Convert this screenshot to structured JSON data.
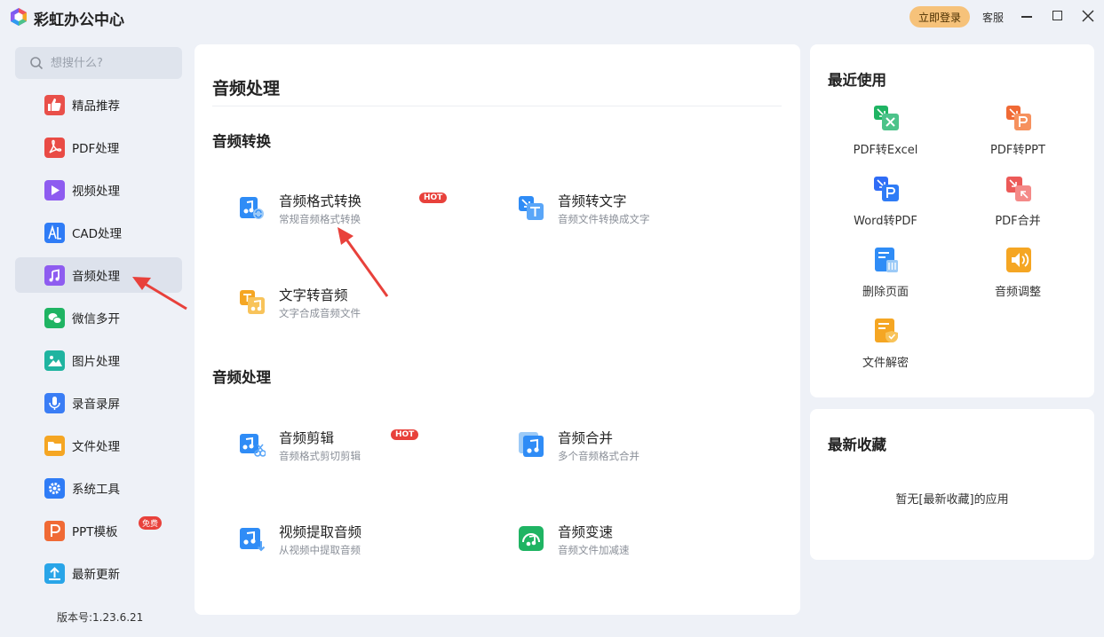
{
  "app": {
    "title": "彩虹办公中心",
    "login_label": "立即登录",
    "service_label": "客服",
    "logo_icon": "rainbow-logo-icon"
  },
  "sidebar": {
    "search_placeholder": "想搜什么?",
    "items": [
      {
        "label": "精品推荐",
        "icon": "thumbs-up-icon",
        "color": "#e9504a"
      },
      {
        "label": "PDF处理",
        "icon": "pdf-icon",
        "color": "#e94b45"
      },
      {
        "label": "视频处理",
        "icon": "play-icon",
        "color": "#8e5cf0"
      },
      {
        "label": "CAD处理",
        "icon": "cad-icon",
        "color": "#2f7cf6"
      },
      {
        "label": "音频处理",
        "icon": "music-icon",
        "color": "#8e5cf0"
      },
      {
        "label": "微信多开",
        "icon": "wechat-icon",
        "color": "#1fb463"
      },
      {
        "label": "图片处理",
        "icon": "image-icon",
        "color": "#1fb4a0"
      },
      {
        "label": "录音录屏",
        "icon": "microphone-icon",
        "color": "#3a7df5"
      },
      {
        "label": "文件处理",
        "icon": "folder-icon",
        "color": "#f5a623"
      },
      {
        "label": "系统工具",
        "icon": "gear-icon",
        "color": "#2f7cf6"
      },
      {
        "label": "PPT模板",
        "icon": "ppt-icon",
        "color": "#f06a35",
        "badge": "免费"
      },
      {
        "label": "最新更新",
        "icon": "upload-icon",
        "color": "#29a5e8"
      }
    ],
    "active_index": 4,
    "version": "版本号:1.23.6.21"
  },
  "main": {
    "title": "音频处理",
    "sections": [
      {
        "title": "音频转换",
        "tools": [
          {
            "name": "音频格式转换",
            "desc": "常规音频格式转换",
            "badge": "HOT",
            "icon": "audio-convert-icon"
          },
          {
            "name": "音频转文字",
            "desc": "音频文件转换成文字",
            "icon": "audio-to-text-icon"
          },
          {
            "name": "文字转音频",
            "desc": "文字合成音频文件",
            "icon": "text-to-audio-icon"
          }
        ]
      },
      {
        "title": "音频处理",
        "tools": [
          {
            "name": "音频剪辑",
            "desc": "音频格式剪切剪辑",
            "badge": "HOT",
            "icon": "audio-cut-icon"
          },
          {
            "name": "音频合并",
            "desc": "多个音频格式合并",
            "icon": "audio-merge-icon"
          },
          {
            "name": "视频提取音频",
            "desc": "从视频中提取音频",
            "icon": "video-extract-audio-icon"
          },
          {
            "name": "音频变速",
            "desc": "音频文件加减速",
            "icon": "audio-speed-icon"
          }
        ]
      }
    ]
  },
  "recent": {
    "title": "最近使用",
    "items": [
      {
        "label": "PDF转Excel",
        "icon": "pdf-to-excel-icon"
      },
      {
        "label": "PDF转PPT",
        "icon": "pdf-to-ppt-icon"
      },
      {
        "label": "Word转PDF",
        "icon": "word-to-pdf-icon"
      },
      {
        "label": "PDF合并",
        "icon": "pdf-merge-icon"
      },
      {
        "label": "删除页面",
        "icon": "delete-page-icon"
      },
      {
        "label": "音频调整",
        "icon": "audio-adjust-icon"
      },
      {
        "label": "文件解密",
        "icon": "file-decrypt-icon"
      }
    ]
  },
  "favorites": {
    "title": "最新收藏",
    "empty_text": "暂无[最新收藏]的应用"
  },
  "colors": {
    "accent_login": "#f6c27a",
    "hot_badge": "#e8413b",
    "annotation_arrow": "#e8413b"
  }
}
